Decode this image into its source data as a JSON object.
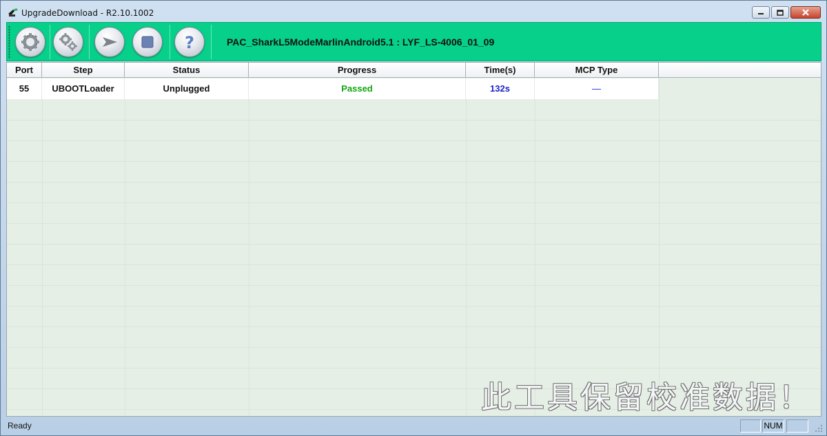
{
  "window": {
    "title": "UpgradeDownload - R2.10.1002"
  },
  "toolbar": {
    "caption": "PAC_SharkL5ModeMarlinAndroid5.1 : LYF_LS-4006_01_09",
    "buttons": [
      {
        "icon": "gear-icon"
      },
      {
        "icon": "gears-icon"
      },
      {
        "icon": "play-arrow-icon"
      },
      {
        "icon": "stop-icon"
      },
      {
        "icon": "help-icon"
      }
    ]
  },
  "table": {
    "columns": [
      "Port",
      "Step",
      "Status",
      "Progress",
      "Time(s)",
      "MCP Type"
    ],
    "rows": [
      {
        "port": "55",
        "step": "UBOOTLoader",
        "status": "Unplugged",
        "progress": "Passed",
        "time": "132s",
        "mcp_type": "—"
      }
    ]
  },
  "colors": {
    "toolbar_bg": "#06d08a",
    "passed": "#11a611",
    "time": "#1a22c8",
    "mcp": "#1a22c8"
  },
  "watermark": "此工具保留校准数据！",
  "status": {
    "text": "Ready",
    "num": "NUM"
  }
}
